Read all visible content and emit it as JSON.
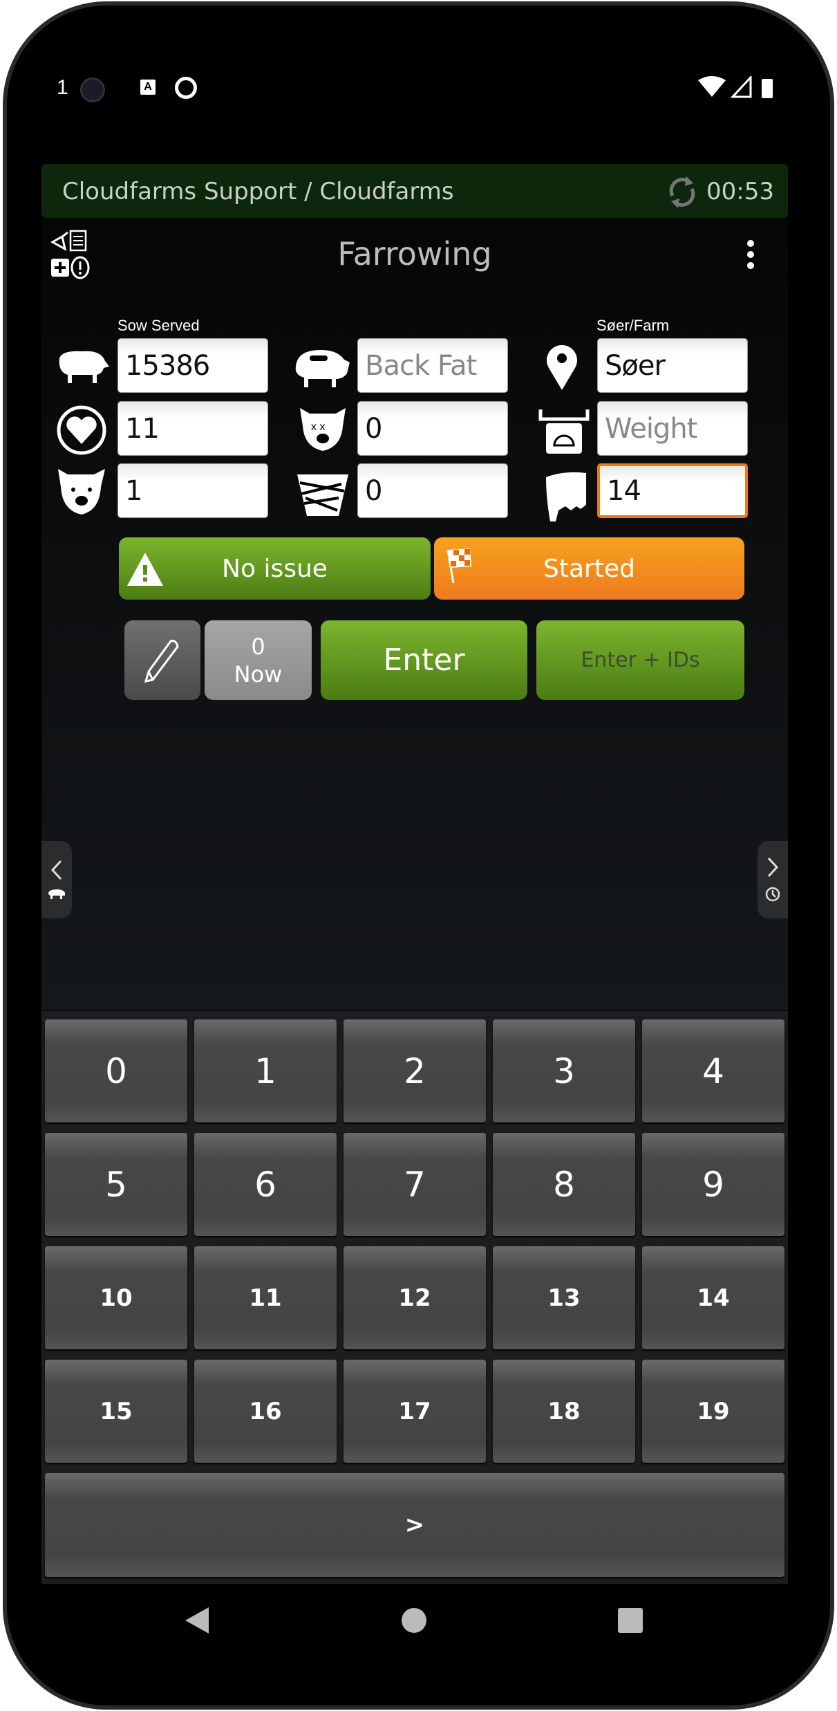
{
  "status_bar": {
    "left_text": "1",
    "icons": [
      "camera-cutout",
      "a-box-icon",
      "at-icon"
    ],
    "right_icons": [
      "wifi-icon",
      "signal-icon",
      "battery-icon"
    ]
  },
  "header": {
    "breadcrumb": "Cloudfarms Support / Cloudfarms",
    "sync_icon": "sync-icon",
    "timer": "00:53",
    "bg_color": "#0e260c"
  },
  "toolbar": {
    "title": "Farrowing",
    "left_icons": [
      "syringe-icon",
      "document-icon",
      "medkit-icon",
      "alert-circle-icon"
    ],
    "menu_icon": "more-vertical-icon"
  },
  "form": {
    "labels": {
      "sow": "Sow Served",
      "farm": "Søer/Farm"
    },
    "fields": [
      {
        "icon": "pig-icon",
        "value": "15386",
        "placeholder": ""
      },
      {
        "icon": "pig-backfat-icon",
        "value": "",
        "placeholder": "Back Fat"
      },
      {
        "icon": "location-pin-icon",
        "value": "Søer",
        "placeholder": ""
      },
      {
        "icon": "heart-circle-icon",
        "value": "11",
        "placeholder": ""
      },
      {
        "icon": "dead-pig-icon",
        "value": "0",
        "placeholder": ""
      },
      {
        "icon": "scale-icon",
        "value": "",
        "placeholder": "Weight"
      },
      {
        "icon": "piglet-face-icon",
        "value": "1",
        "placeholder": ""
      },
      {
        "icon": "mummy-icon",
        "value": "0",
        "placeholder": ""
      },
      {
        "icon": "teats-icon",
        "value": "14",
        "placeholder": "",
        "focused": true
      }
    ]
  },
  "status_buttons": {
    "issue": {
      "label": "No issue",
      "icon": "warning-icon",
      "color": "#6aa322"
    },
    "state": {
      "label": "Started",
      "icon": "checkered-flag-icon",
      "color": "#f28c1f"
    }
  },
  "actions": {
    "edit_icon": "pencil-icon",
    "now_count": "0",
    "now_label": "Now",
    "enter": "Enter",
    "enter_ids": "Enter + IDs"
  },
  "side_tabs": {
    "left": {
      "icon": "chevron-left-icon",
      "sub": "pig-icon"
    },
    "right": {
      "icon": "chevron-right-icon",
      "sub": "clock-icon"
    }
  },
  "keypad": {
    "keys": [
      "0",
      "1",
      "2",
      "3",
      "4",
      "5",
      "6",
      "7",
      "8",
      "9",
      "10",
      "11",
      "12",
      "13",
      "14",
      "15",
      "16",
      "17",
      "18",
      "19"
    ],
    "next": ">"
  },
  "nav": {
    "back": "back-icon",
    "home": "home-icon",
    "recents": "recents-icon"
  },
  "accent_color": "#f07a10"
}
